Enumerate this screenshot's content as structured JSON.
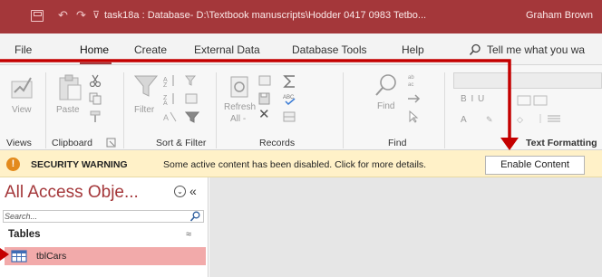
{
  "title_bar": {
    "qat_undo_glyph": "↶",
    "qat_redo_glyph": "↷",
    "qat_customize_glyph": "⊽",
    "document_title": "task18a : Database- D:\\Textbook manuscripts\\Hodder 0417 0983 Tetbo...",
    "user_name": "Graham Brown"
  },
  "tabs": {
    "file": "File",
    "home": "Home",
    "create": "Create",
    "external_data": "External Data",
    "database_tools": "Database Tools",
    "help": "Help",
    "tell_me": "Tell me what you wa"
  },
  "ribbon": {
    "view_label": "View",
    "paste_label": "Paste",
    "filter_label": "Filter",
    "refresh_label": "Refresh",
    "all_label": "All -",
    "find_label": "Find",
    "format_letters": "B  I  U",
    "groups": {
      "views": "Views",
      "clipboard": "Clipboard",
      "sort_filter": "Sort & Filter",
      "records": "Records",
      "find": "Find",
      "text_formatting": "Text Formatting"
    }
  },
  "security_bar": {
    "icon_glyph": "!",
    "title": "SECURITY WARNING",
    "message": "Some active content has been disabled. Click for more details.",
    "button": "Enable Content"
  },
  "navigation_pane": {
    "title": "All Access Obje...",
    "menu_glyph": "⌄",
    "collapse_glyph": "«",
    "search_placeholder": "Search...",
    "section": "Tables",
    "section_chevron": "≈",
    "items": [
      {
        "label": "tblCars"
      }
    ]
  },
  "colors": {
    "title_bar": "#a4373a",
    "accent": "#a4373a",
    "warning_bar": "#fff1c8",
    "selected_item": "#f2aaaa",
    "callout_arrow": "#c40000"
  }
}
